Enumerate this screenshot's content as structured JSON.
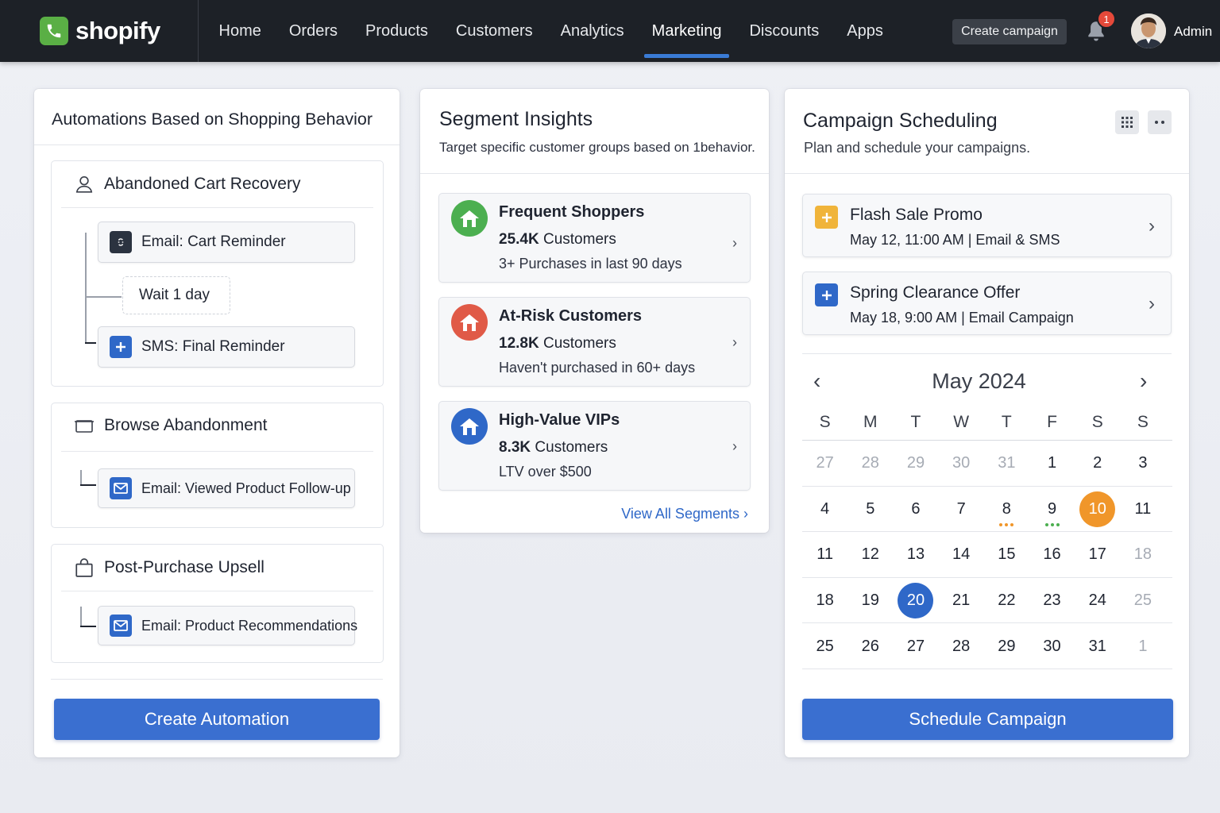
{
  "brand": {
    "name": "shopify",
    "logo_icon": "phone-icon",
    "logo_color": "#5aaf45"
  },
  "nav": {
    "items": [
      {
        "label": "Home"
      },
      {
        "label": "Orders"
      },
      {
        "label": "Products"
      },
      {
        "label": "Customers"
      },
      {
        "label": "Analytics"
      },
      {
        "label": "Marketing",
        "active": true
      },
      {
        "label": "Discounts"
      },
      {
        "label": "Apps"
      }
    ],
    "create_campaign_label": "Create campaign",
    "notification_count": "1",
    "user_label": "Admin",
    "accent_color": "#3a7bd5"
  },
  "automations": {
    "title": "Automations Based on Shopping Behavior",
    "abandoned": {
      "title": "Abandoned Cart Recovery",
      "step1": "Email: Cart Reminder",
      "wait": "Wait 1 day",
      "step2": "SMS: Final Reminder"
    },
    "browse": {
      "title": "Browse Abandonment",
      "step1": "Email: Viewed Product Follow-up"
    },
    "upsell": {
      "title": "Post-Purchase Upsell",
      "step1": "Email: Product Recommendations"
    },
    "create_button": "Create Automation"
  },
  "segments": {
    "title": "Segment Insights",
    "subtitle": "Target specific customer groups based on 1behavior.",
    "items": [
      {
        "name": "Frequent Shoppers",
        "count": "25.4K",
        "unit": "Customers",
        "desc": "3+ Purchases in last 90 days",
        "color": "#4caf50"
      },
      {
        "name": "At-Risk Customers",
        "count": "12.8K",
        "unit": "Customers",
        "desc": "Haven't purchased in 60+ days",
        "color": "#e05a47"
      },
      {
        "name": "High-Value VIPs",
        "count": "8.3K",
        "unit": "Customers",
        "desc": "LTV over $500",
        "color": "#2f68c8"
      }
    ],
    "view_all": "View All Segments"
  },
  "scheduling": {
    "title": "Campaign Scheduling",
    "subtitle": "Plan and schedule your campaigns.",
    "campaigns": [
      {
        "name": "Flash Sale Promo",
        "meta": "May 12, 11:00 AM | Email & SMS",
        "color": "#f0b43a"
      },
      {
        "name": "Spring Clearance Offer",
        "meta": "May 18, 9:00 AM | Email Campaign",
        "color": "#2f68c8"
      }
    ],
    "calendar": {
      "month": "May 2024",
      "dow": [
        "S",
        "M",
        "T",
        "W",
        "T",
        "F",
        "S",
        "S"
      ],
      "weeks": [
        [
          "27",
          "28",
          "29",
          "30",
          "31",
          "1",
          "2",
          "3"
        ],
        [
          "4",
          "5",
          "6",
          "7",
          "8",
          "9",
          "10",
          "11"
        ],
        [
          "11",
          "12",
          "13",
          "14",
          "15",
          "16",
          "17",
          "18"
        ],
        [
          "18",
          "19",
          "20",
          "21",
          "22",
          "23",
          "24",
          "25"
        ],
        [
          "25",
          "26",
          "27",
          "28",
          "29",
          "30",
          "31",
          "1"
        ]
      ],
      "highlight_orange": "10",
      "highlight_blue": "20",
      "orange": "#f0962a",
      "blue": "#2f68c8"
    },
    "schedule_button": "Schedule Campaign"
  }
}
